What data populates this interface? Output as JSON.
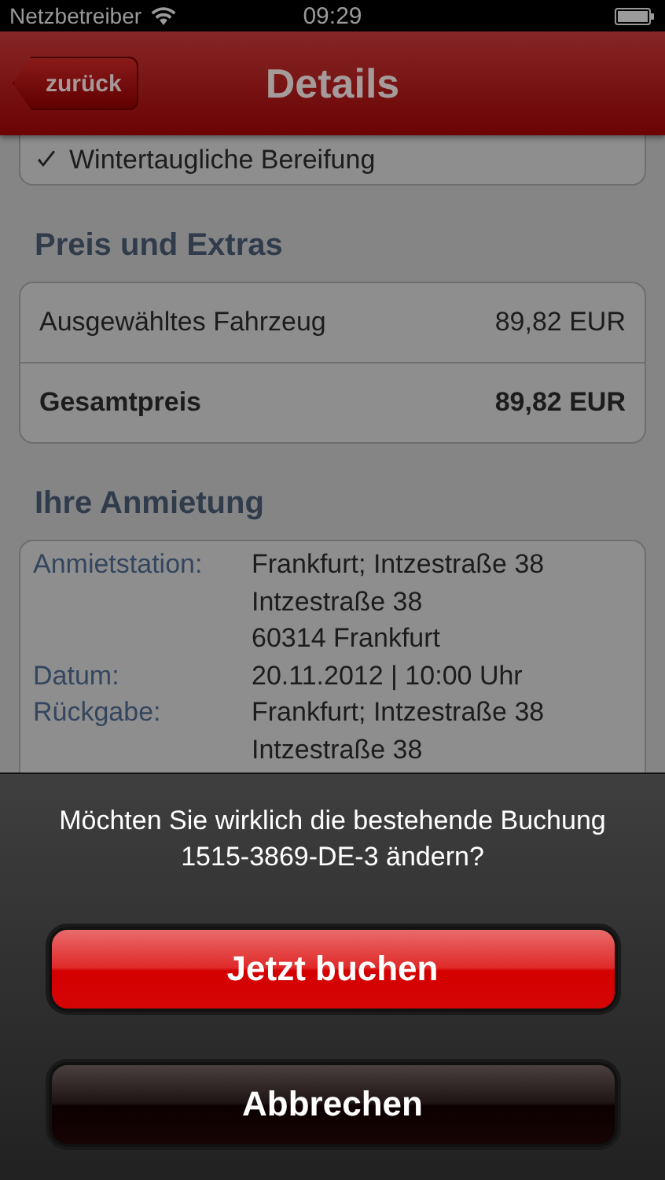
{
  "status_bar": {
    "carrier": "Netzbetreiber",
    "time": "09:29"
  },
  "nav": {
    "back": "zurück",
    "title": "Details"
  },
  "extras_list": [
    {
      "label": "Wintertaugliche Bereifung",
      "checked": true
    }
  ],
  "sections": [
    {
      "title": "Preis und Extras",
      "kind": "price",
      "rows": [
        {
          "label": "Ausgewähltes Fahrzeug",
          "value": "89,82 EUR",
          "total": false
        },
        {
          "label": "Gesamtpreis",
          "value": "89,82 EUR",
          "total": true
        }
      ]
    },
    {
      "title": "Ihre Anmietung",
      "kind": "details",
      "rows": [
        {
          "label": "Anmietstation:",
          "lines": [
            "Frankfurt; Intzestraße 38",
            "Intzestraße 38",
            "60314 Frankfurt"
          ]
        },
        {
          "label": "Datum:",
          "lines": [
            "20.11.2012 | 10:00 Uhr"
          ]
        },
        {
          "label": "Rückgabe:",
          "lines": [
            "Frankfurt; Intzestraße 38",
            "Intzestraße 38"
          ]
        }
      ]
    }
  ],
  "action_sheet": {
    "message": "Möchten Sie wirklich die bestehende Buchung 1515-3869-DE-3 ändern?",
    "buttons": [
      {
        "label": "Jetzt buchen",
        "kind": "destructive"
      },
      {
        "label": "Abbrechen",
        "kind": "cancel"
      }
    ]
  }
}
